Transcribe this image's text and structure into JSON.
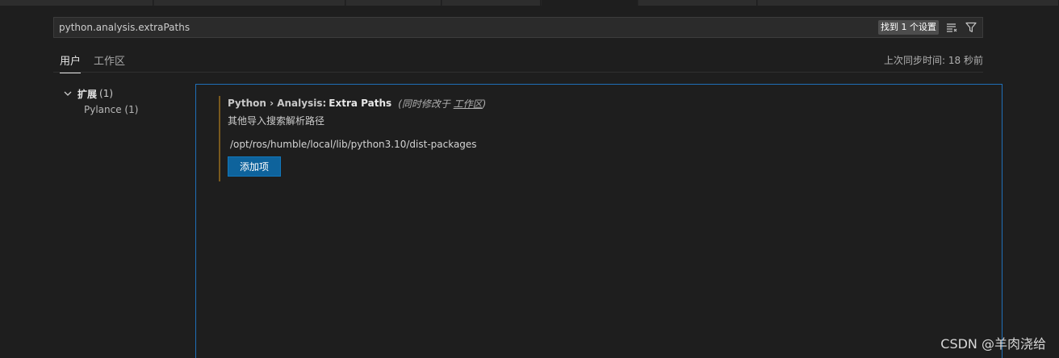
{
  "search": {
    "value": "python.analysis.extraPaths",
    "result_badge": "找到 1 个设置"
  },
  "scope_tabs": [
    {
      "label": "用户",
      "active": true
    },
    {
      "label": "工作区",
      "active": false
    }
  ],
  "sync_status": "上次同步时间: 18 秒前",
  "tree": {
    "group": {
      "label": "扩展",
      "count": "(1)"
    },
    "children": [
      {
        "label": "Pylance (1)"
      }
    ]
  },
  "setting": {
    "category": "Python › Analysis:",
    "key": "Extra Paths",
    "modified_prefix": "(同时修改于 ",
    "modified_link": "工作区",
    "modified_suffix": ")",
    "description": "其他导入搜索解析路径",
    "items": [
      "/opt/ros/humble/local/lib/python3.10/dist-packages"
    ],
    "add_button_label": "添加项"
  },
  "watermark": "CSDN @羊肉浇给",
  "colors": {
    "background": "#1e1e1e",
    "accent_border": "#1f6fb8",
    "button": "#0e639c",
    "modified_indicator": "#7a5a1e"
  }
}
